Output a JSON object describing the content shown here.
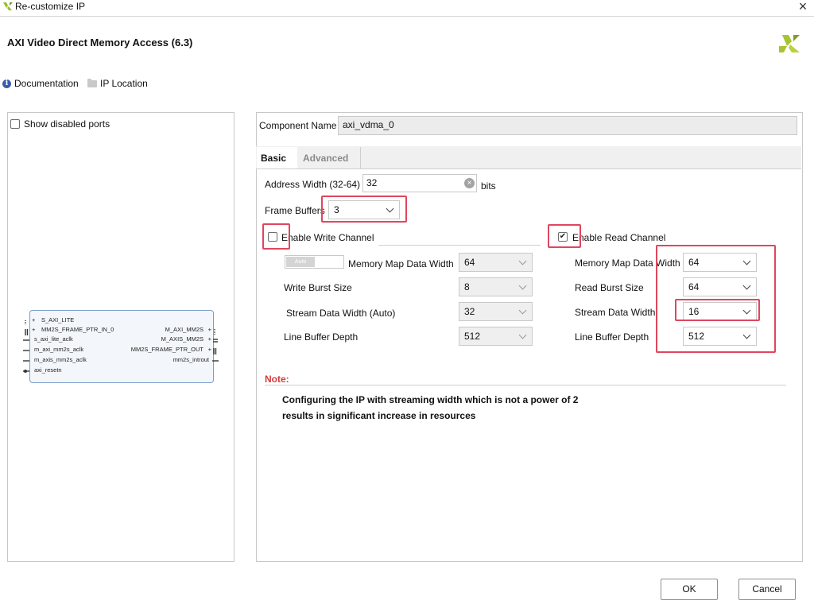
{
  "window": {
    "title": "Re-customize IP"
  },
  "header": {
    "ip_title": "AXI Video Direct Memory Access (6.3)"
  },
  "links": {
    "documentation": "Documentation",
    "ip_location": "IP Location"
  },
  "left": {
    "show_disabled_ports": "Show disabled ports",
    "block": {
      "left_ports": [
        "S_AXI_LITE",
        "MM2S_FRAME_PTR_IN_0",
        "s_axi_lite_aclk",
        "m_axi_mm2s_aclk",
        "m_axis_mm2s_aclk",
        "axi_resetn"
      ],
      "right_ports": [
        "M_AXI_MM2S",
        "M_AXIS_MM2S",
        "MM2S_FRAME_PTR_OUT",
        "mm2s_introut"
      ]
    }
  },
  "component": {
    "label": "Component Name",
    "value": "axi_vdma_0"
  },
  "tabs": {
    "basic": "Basic",
    "advanced": "Advanced"
  },
  "basic": {
    "address_width_label": "Address Width (32-64)",
    "address_width_value": "32",
    "address_width_unit": "bits",
    "frame_buffers_label": "Frame Buffers",
    "frame_buffers_value": "3",
    "write_channel": {
      "label": "Enable Write Channel",
      "enabled": false,
      "toggle_text": "Auto",
      "mm_data_width_label": "Memory Map Data Width",
      "mm_data_width": "64",
      "burst_size_label": "Write Burst Size",
      "burst_size": "8",
      "stream_width_label": "Stream Data Width (Auto)",
      "stream_width": "32",
      "line_buffer_label": "Line Buffer Depth",
      "line_buffer": "512"
    },
    "read_channel": {
      "label": "Enable Read Channel",
      "enabled": true,
      "mm_data_width_label": "Memory Map Data Width",
      "mm_data_width": "64",
      "burst_size_label": "Read Burst Size",
      "burst_size": "64",
      "stream_width_label": "Stream Data Width",
      "stream_width": "16",
      "line_buffer_label": "Line Buffer Depth",
      "line_buffer": "512"
    },
    "note_label": "Note:",
    "note_line1": "Configuring the IP with streaming width which is not a power of 2",
    "note_line2": "results in significant increase in resources"
  },
  "buttons": {
    "ok": "OK",
    "cancel": "Cancel"
  },
  "colors": {
    "highlight": "#e0465e",
    "note": "#d43a3a",
    "block_border": "#7a9dc9"
  }
}
